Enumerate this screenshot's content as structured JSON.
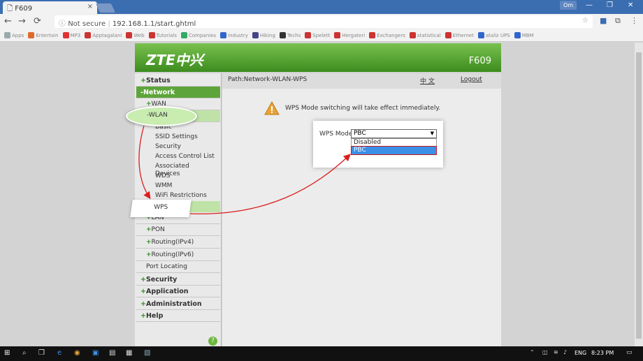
{
  "browser": {
    "tab_title": "F609",
    "tab_close": "×",
    "profile": "Om",
    "min": "—",
    "max": "❐",
    "close": "✕",
    "security_label": "Not secure",
    "url": "192.168.1.1/start.ghtml",
    "bookmarks": [
      "Apps",
      "Entertain",
      "MP3",
      "Apptagalani",
      "Web",
      "Tutorials",
      "Companies",
      "Industry",
      "Hiking",
      "Techs",
      "Spelett",
      "Hergateri",
      "Exchangers",
      "statistical",
      "Ethernet",
      "ataliz UPS",
      "MBM"
    ]
  },
  "router": {
    "logo": "ZTE中兴",
    "model": "F609",
    "path": "Path:Network-WLAN-WPS",
    "lang": "中 文",
    "logout": "Logout"
  },
  "sidebar": {
    "status": "Status",
    "network": "-Network",
    "wan": "WAN",
    "wlan": "-WLAN",
    "wlan_items": [
      "Basic",
      "SSID Settings",
      "Security",
      "Access Control List",
      "Associated Devices",
      "WDS",
      "WMM",
      "WiFi Restrictions",
      "WPS"
    ],
    "lan": "LAN",
    "pon": "PON",
    "routing4": "Routing(IPv4)",
    "routing6": "Routing(IPv6)",
    "port_locating": "Port Locating",
    "security": "Security",
    "application": "Application",
    "administration": "Administration",
    "help": "Help",
    "help_icon_glyph": "?"
  },
  "wps": {
    "warning": "WPS Mode switching will take effect immediately.",
    "label": "WPS Mode",
    "selected": "PBC",
    "options": [
      "Disabled",
      "PBC"
    ]
  },
  "taskbar": {
    "lang": "ENG",
    "time": "8:23 PM"
  },
  "colors": {
    "accent_green": "#5da53a",
    "highlight_red": "#d91e1e",
    "select_blue": "#3c8fe6"
  }
}
